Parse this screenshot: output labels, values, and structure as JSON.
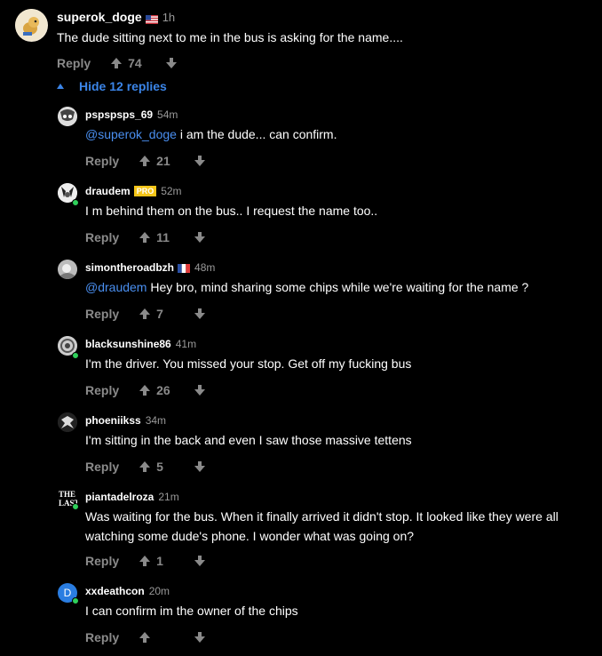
{
  "op": {
    "username": "superok_doge",
    "time": "1h",
    "text": "The dude sitting next to me in the bus is asking for the name....",
    "reply_label": "Reply",
    "score": "74"
  },
  "hide_replies_label": "Hide 12 replies",
  "replies": [
    {
      "username": "pspspsps_69",
      "time": "54m",
      "mention": "@superok_doge",
      "text": " i am the dude... can confirm.",
      "reply_label": "Reply",
      "score": "21"
    },
    {
      "username": "draudem",
      "badge": "PRO",
      "time": "52m",
      "mention": "",
      "text": "I m behind them on the bus.. I request the name too..",
      "reply_label": "Reply",
      "score": "11"
    },
    {
      "username": "simontheroadbzh",
      "time": "48m",
      "mention": "@draudem",
      "text": " Hey bro, mind sharing some chips while we're waiting for the name ?",
      "reply_label": "Reply",
      "score": "7"
    },
    {
      "username": "blacksunshine86",
      "time": "41m",
      "mention": "",
      "text": "I'm the driver. You missed your stop. Get off my fucking bus",
      "reply_label": "Reply",
      "score": "26"
    },
    {
      "username": "phoeniikss",
      "time": "34m",
      "mention": "",
      "text": "I'm sitting in the back and even I saw those massive tettens",
      "reply_label": "Reply",
      "score": "5"
    },
    {
      "username": "piantadelroza",
      "time": "21m",
      "mention": "",
      "text_line1": "Was waiting for the bus. When it finally arrived it didn't stop. It looked like they were all",
      "text_line2": "watching some dude's phone. I wonder what was going on?",
      "reply_label": "Reply",
      "score": "1"
    },
    {
      "username": "xxdeathcon",
      "time": "20m",
      "avatar_letter": "D",
      "mention": "",
      "text": "I can confirm im the owner of the chips",
      "reply_label": "Reply",
      "score": ""
    }
  ],
  "colors": {
    "accent": "#3b85e8",
    "muted": "#8a8a8a",
    "online": "#2fd05a",
    "pro": "#f5c518"
  }
}
